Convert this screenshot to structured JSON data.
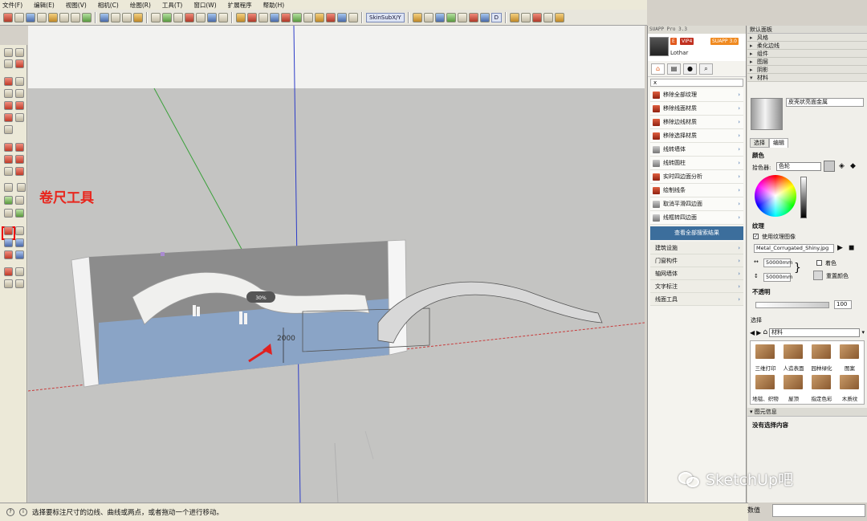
{
  "menubar": [
    "文件(F)",
    "编辑(E)",
    "视图(V)",
    "相机(C)",
    "绘图(R)",
    "工具(T)",
    "窗口(W)",
    "扩展程序",
    "帮助(H)"
  ],
  "toolbar": {
    "skin_label": "SkinSubX/Y",
    "d_label": "D"
  },
  "annotation": {
    "text": "卷尺工具"
  },
  "viewport": {
    "dimension_label": "2000",
    "sign_label": "30%",
    "colors": {
      "arrow": "#e02020",
      "blue_axis": "#2c3cc8",
      "green_axis": "#3aa03a",
      "red_axis": "#c83c3c"
    }
  },
  "status": {
    "text": "选择要标注尺寸的边线、曲线或两点，或者拖动一个进行移动。"
  },
  "plugin": {
    "title": "SUAPP Pro 3.3",
    "user": "Lothar",
    "badge_a": "VIP4",
    "badge_b": "SUAPP 3.0",
    "search_placeholder": "x",
    "items": [
      {
        "label": "移除全部纹理"
      },
      {
        "label": "移除线面材质"
      },
      {
        "label": "移除边线材质"
      },
      {
        "label": "移除选择材质"
      },
      {
        "label": "线转墙体"
      },
      {
        "label": "线转圆柱"
      },
      {
        "label": "实时四边面分析"
      },
      {
        "label": "绘制线条"
      },
      {
        "label": "取消平滑四边面"
      },
      {
        "label": "线框转四边面"
      }
    ],
    "more": "查看全部搜索结果",
    "categories": [
      "建筑设施",
      "门窗构件",
      "轴网墙体",
      "文字标注",
      "线面工具"
    ]
  },
  "tray": {
    "title": "默认面板",
    "rows": [
      "风格",
      "柔化边线",
      "组件",
      "图层",
      "阴影",
      "材料"
    ],
    "material_name": "皮壳状亮面金属",
    "tabs": [
      "选择",
      "编辑"
    ],
    "color_heading": "颜色",
    "picker_label": "拾色器:",
    "picker_value": "色轮",
    "texture_heading": "纹理",
    "use_texture": "使用纹理图像",
    "texture_file": "Metal_Corrugated_Shiny.jpg",
    "width": "50000mm",
    "height": "50000mm",
    "colorize": "着色",
    "reset_color": "重置颜色",
    "opacity_heading": "不透明",
    "opacity_value": "100",
    "select_heading": "选择",
    "library": "材料",
    "materials": [
      "三维打印",
      "人造表面",
      "园林绿化",
      "图案",
      "地毯、织物",
      "屋顶",
      "指定色彩",
      "木质纹"
    ],
    "entity_heading": "图元信息",
    "entity_empty": "没有选择内容"
  },
  "value_label": "数值",
  "watermark": "SketchUp吧"
}
